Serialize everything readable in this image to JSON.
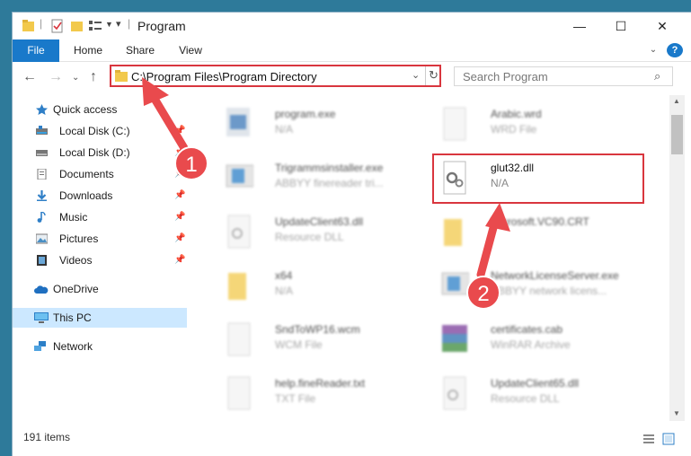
{
  "window": {
    "title": "Program",
    "controls": {
      "minimize": "—",
      "maximize": "☐",
      "close": "✕"
    }
  },
  "ribbon": {
    "tabs": [
      "File",
      "Home",
      "Share",
      "View"
    ],
    "expand_icon": "chevron-down-icon",
    "help": "?"
  },
  "nav": {
    "address": "C:\\Program Files\\Program Directory",
    "search_placeholder": "Search Program"
  },
  "sidebar": {
    "items": [
      {
        "label": "Quick access",
        "icon": "star-icon"
      },
      {
        "label": "Local Disk (C:)",
        "icon": "drive-icon"
      },
      {
        "label": "Local Disk (D:)",
        "icon": "drive-icon"
      },
      {
        "label": "Documents",
        "icon": "documents-icon"
      },
      {
        "label": "Downloads",
        "icon": "downloads-icon"
      },
      {
        "label": "Music",
        "icon": "music-icon"
      },
      {
        "label": "Pictures",
        "icon": "pictures-icon"
      },
      {
        "label": "Videos",
        "icon": "videos-icon"
      },
      {
        "label": "OneDrive",
        "icon": "cloud-icon"
      },
      {
        "label": "This PC",
        "icon": "computer-icon"
      },
      {
        "label": "Network",
        "icon": "network-icon"
      }
    ]
  },
  "files": [
    {
      "name": "program.exe",
      "type": "N/A"
    },
    {
      "name": "Arabic.wrd",
      "type": "WRD File"
    },
    {
      "name": "Trigrammsinstaller.exe",
      "type": "ABBYY finereader tri..."
    },
    {
      "name": "glut32.dll",
      "type": "N/A"
    },
    {
      "name": "UpdateClient63.dll",
      "type": "Resource DLL"
    },
    {
      "name": "Microsoft.VC90.CRT",
      "type": ""
    },
    {
      "name": "x64",
      "type": "N/A"
    },
    {
      "name": "NetworkLicenseServer.exe",
      "type": "ABBYY network licens..."
    },
    {
      "name": "SndToWP16.wcm",
      "type": "WCM File"
    },
    {
      "name": "certificates.cab",
      "type": "WinRAR Archive"
    },
    {
      "name": "help.fineReader.txt",
      "type": "TXT File"
    },
    {
      "name": "UpdateClient65.dll",
      "type": "Resource DLL"
    }
  ],
  "status": {
    "item_count": "191 items"
  },
  "annotations": {
    "step1": "1",
    "step2": "2"
  },
  "colors": {
    "accent": "#1979ca",
    "highlight": "#d9363e",
    "selected": "#cce8ff"
  }
}
